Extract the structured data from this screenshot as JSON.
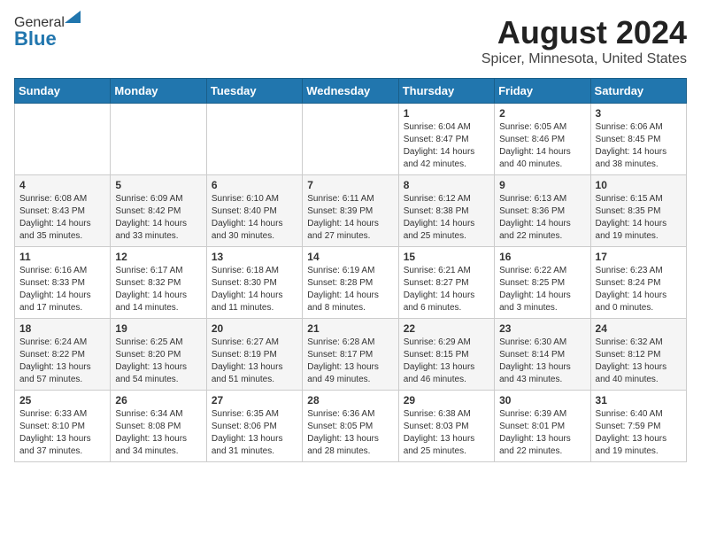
{
  "header": {
    "logo_general": "General",
    "logo_blue": "Blue",
    "title": "August 2024",
    "subtitle": "Spicer, Minnesota, United States"
  },
  "days_of_week": [
    "Sunday",
    "Monday",
    "Tuesday",
    "Wednesday",
    "Thursday",
    "Friday",
    "Saturday"
  ],
  "weeks": [
    [
      {
        "day": "",
        "info": ""
      },
      {
        "day": "",
        "info": ""
      },
      {
        "day": "",
        "info": ""
      },
      {
        "day": "",
        "info": ""
      },
      {
        "day": "1",
        "info": "Sunrise: 6:04 AM\nSunset: 8:47 PM\nDaylight: 14 hours and 42 minutes."
      },
      {
        "day": "2",
        "info": "Sunrise: 6:05 AM\nSunset: 8:46 PM\nDaylight: 14 hours and 40 minutes."
      },
      {
        "day": "3",
        "info": "Sunrise: 6:06 AM\nSunset: 8:45 PM\nDaylight: 14 hours and 38 minutes."
      }
    ],
    [
      {
        "day": "4",
        "info": "Sunrise: 6:08 AM\nSunset: 8:43 PM\nDaylight: 14 hours and 35 minutes."
      },
      {
        "day": "5",
        "info": "Sunrise: 6:09 AM\nSunset: 8:42 PM\nDaylight: 14 hours and 33 minutes."
      },
      {
        "day": "6",
        "info": "Sunrise: 6:10 AM\nSunset: 8:40 PM\nDaylight: 14 hours and 30 minutes."
      },
      {
        "day": "7",
        "info": "Sunrise: 6:11 AM\nSunset: 8:39 PM\nDaylight: 14 hours and 27 minutes."
      },
      {
        "day": "8",
        "info": "Sunrise: 6:12 AM\nSunset: 8:38 PM\nDaylight: 14 hours and 25 minutes."
      },
      {
        "day": "9",
        "info": "Sunrise: 6:13 AM\nSunset: 8:36 PM\nDaylight: 14 hours and 22 minutes."
      },
      {
        "day": "10",
        "info": "Sunrise: 6:15 AM\nSunset: 8:35 PM\nDaylight: 14 hours and 19 minutes."
      }
    ],
    [
      {
        "day": "11",
        "info": "Sunrise: 6:16 AM\nSunset: 8:33 PM\nDaylight: 14 hours and 17 minutes."
      },
      {
        "day": "12",
        "info": "Sunrise: 6:17 AM\nSunset: 8:32 PM\nDaylight: 14 hours and 14 minutes."
      },
      {
        "day": "13",
        "info": "Sunrise: 6:18 AM\nSunset: 8:30 PM\nDaylight: 14 hours and 11 minutes."
      },
      {
        "day": "14",
        "info": "Sunrise: 6:19 AM\nSunset: 8:28 PM\nDaylight: 14 hours and 8 minutes."
      },
      {
        "day": "15",
        "info": "Sunrise: 6:21 AM\nSunset: 8:27 PM\nDaylight: 14 hours and 6 minutes."
      },
      {
        "day": "16",
        "info": "Sunrise: 6:22 AM\nSunset: 8:25 PM\nDaylight: 14 hours and 3 minutes."
      },
      {
        "day": "17",
        "info": "Sunrise: 6:23 AM\nSunset: 8:24 PM\nDaylight: 14 hours and 0 minutes."
      }
    ],
    [
      {
        "day": "18",
        "info": "Sunrise: 6:24 AM\nSunset: 8:22 PM\nDaylight: 13 hours and 57 minutes."
      },
      {
        "day": "19",
        "info": "Sunrise: 6:25 AM\nSunset: 8:20 PM\nDaylight: 13 hours and 54 minutes."
      },
      {
        "day": "20",
        "info": "Sunrise: 6:27 AM\nSunset: 8:19 PM\nDaylight: 13 hours and 51 minutes."
      },
      {
        "day": "21",
        "info": "Sunrise: 6:28 AM\nSunset: 8:17 PM\nDaylight: 13 hours and 49 minutes."
      },
      {
        "day": "22",
        "info": "Sunrise: 6:29 AM\nSunset: 8:15 PM\nDaylight: 13 hours and 46 minutes."
      },
      {
        "day": "23",
        "info": "Sunrise: 6:30 AM\nSunset: 8:14 PM\nDaylight: 13 hours and 43 minutes."
      },
      {
        "day": "24",
        "info": "Sunrise: 6:32 AM\nSunset: 8:12 PM\nDaylight: 13 hours and 40 minutes."
      }
    ],
    [
      {
        "day": "25",
        "info": "Sunrise: 6:33 AM\nSunset: 8:10 PM\nDaylight: 13 hours and 37 minutes."
      },
      {
        "day": "26",
        "info": "Sunrise: 6:34 AM\nSunset: 8:08 PM\nDaylight: 13 hours and 34 minutes."
      },
      {
        "day": "27",
        "info": "Sunrise: 6:35 AM\nSunset: 8:06 PM\nDaylight: 13 hours and 31 minutes."
      },
      {
        "day": "28",
        "info": "Sunrise: 6:36 AM\nSunset: 8:05 PM\nDaylight: 13 hours and 28 minutes."
      },
      {
        "day": "29",
        "info": "Sunrise: 6:38 AM\nSunset: 8:03 PM\nDaylight: 13 hours and 25 minutes."
      },
      {
        "day": "30",
        "info": "Sunrise: 6:39 AM\nSunset: 8:01 PM\nDaylight: 13 hours and 22 minutes."
      },
      {
        "day": "31",
        "info": "Sunrise: 6:40 AM\nSunset: 7:59 PM\nDaylight: 13 hours and 19 minutes."
      }
    ]
  ]
}
